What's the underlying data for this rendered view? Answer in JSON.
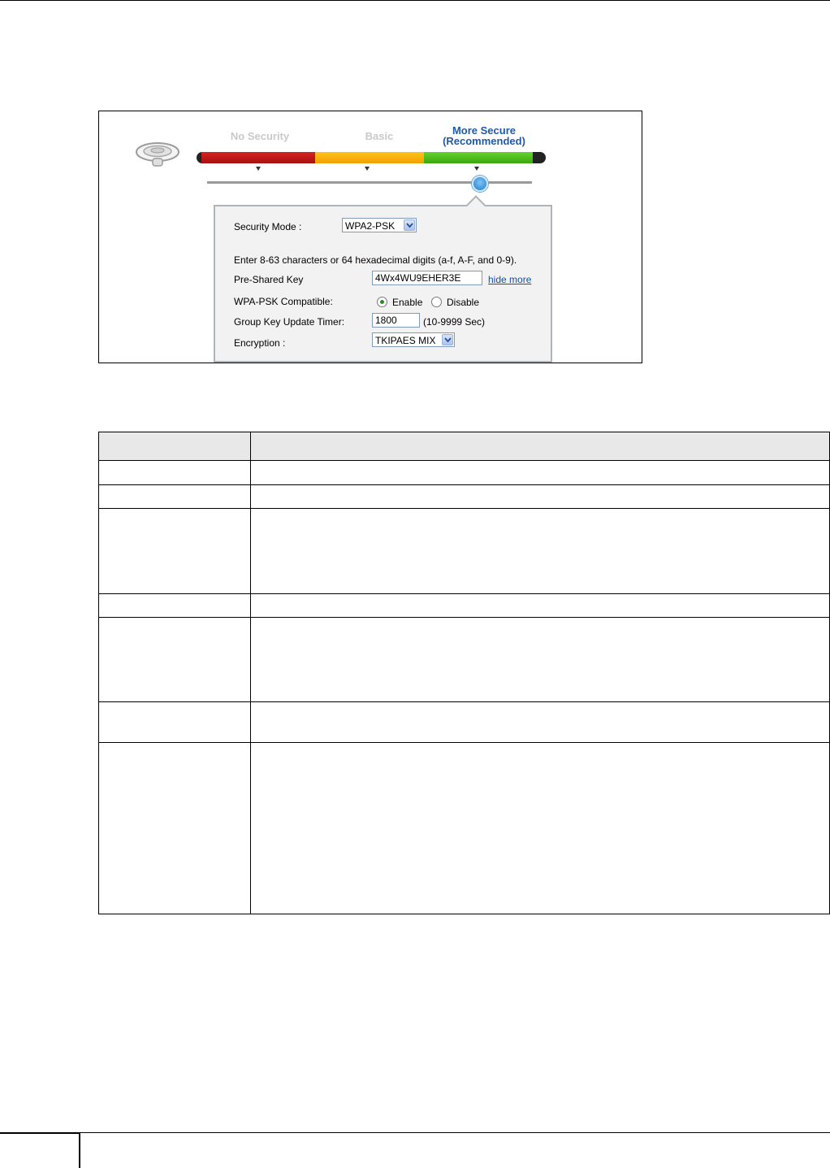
{
  "security_panel": {
    "levels": {
      "no_security": "No Security",
      "basic": "Basic",
      "more_secure_line1": "More Secure",
      "more_secure_line2": "(Recommended)"
    },
    "selected_level": "More Secure (Recommended)",
    "security_mode_label": "Security Mode :",
    "security_mode_value": "WPA2-PSK",
    "instructions": "Enter 8-63 characters or 64 hexadecimal digits (a-f, A-F, and 0-9).",
    "psk_label": "Pre-Shared Key",
    "psk_value": "4Wx4WU9EHER3E",
    "hide_more_link": "hide more",
    "wpa_compat_label": "WPA-PSK Compatible:",
    "enable_label": "Enable",
    "disable_label": "Disable",
    "wpa_compat_selected": "Enable",
    "group_key_label": "Group Key Update Timer:",
    "group_key_value": "1800",
    "group_key_range": "(10-9999 Sec)",
    "encryption_label": "Encryption :",
    "encryption_value": "TKIPAES MIX"
  },
  "colors": {
    "no_security": "#c0120f",
    "basic": "#fbb40a",
    "more_secure": "#4cc11a",
    "selected_level_text": "#1e5aa8",
    "link": "#1a4fa0"
  },
  "icons": [
    "router-icon",
    "dropdown-arrow-icon",
    "slider-knob-icon"
  ]
}
